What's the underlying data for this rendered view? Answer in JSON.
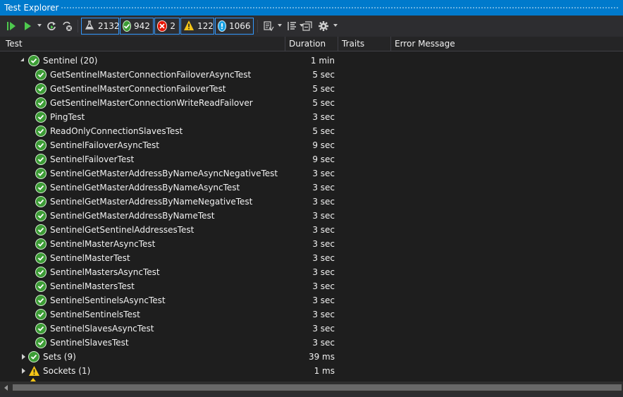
{
  "window": {
    "title": "Test Explorer",
    "accent_color": "#007acc"
  },
  "toolbar": {
    "buttons": [
      {
        "name": "run-all-icon"
      },
      {
        "name": "run-icon"
      },
      {
        "name": "repeat-last-run-icon"
      },
      {
        "name": "cancel-run-icon"
      }
    ],
    "counters": [
      {
        "name": "total-tests-counter",
        "icon": "flask-icon",
        "value": "2132"
      },
      {
        "name": "passed-tests-counter",
        "icon": "passed-icon",
        "value": "942"
      },
      {
        "name": "failed-tests-counter",
        "icon": "failed-icon",
        "value": "2"
      },
      {
        "name": "warning-tests-counter",
        "icon": "warning-icon",
        "value": "122"
      },
      {
        "name": "not-run-tests-counter",
        "icon": "info-icon",
        "value": "1066"
      }
    ],
    "right_buttons": [
      {
        "name": "playlist-icon"
      },
      {
        "name": "group-by-icon"
      },
      {
        "name": "collapse-all-icon"
      },
      {
        "name": "settings-gear-icon"
      }
    ]
  },
  "columns": [
    "Test",
    "Duration",
    "Traits",
    "Error Message"
  ],
  "groups": {
    "sentinel": {
      "label": "Sentinel",
      "count": "(20)",
      "duration": "1 min",
      "status": "passed"
    },
    "sets": {
      "label": "Sets",
      "count": "(9)",
      "duration": "39 ms",
      "status": "passed"
    },
    "sockets": {
      "label": "Sockets",
      "count": "(1)",
      "duration": "1 ms",
      "status": "warning"
    }
  },
  "tests": [
    {
      "name": "GetSentinelMasterConnectionFailoverAsyncTest",
      "duration": "5 sec",
      "status": "passed"
    },
    {
      "name": "GetSentinelMasterConnectionFailoverTest",
      "duration": "5 sec",
      "status": "passed"
    },
    {
      "name": "GetSentinelMasterConnectionWriteReadFailover",
      "duration": "5 sec",
      "status": "passed"
    },
    {
      "name": "PingTest",
      "duration": "3 sec",
      "status": "passed"
    },
    {
      "name": "ReadOnlyConnectionSlavesTest",
      "duration": "5 sec",
      "status": "passed"
    },
    {
      "name": "SentinelFailoverAsyncTest",
      "duration": "9 sec",
      "status": "passed"
    },
    {
      "name": "SentinelFailoverTest",
      "duration": "9 sec",
      "status": "passed"
    },
    {
      "name": "SentinelGetMasterAddressByNameAsyncNegativeTest",
      "duration": "3 sec",
      "status": "passed"
    },
    {
      "name": "SentinelGetMasterAddressByNameAsyncTest",
      "duration": "3 sec",
      "status": "passed"
    },
    {
      "name": "SentinelGetMasterAddressByNameNegativeTest",
      "duration": "3 sec",
      "status": "passed"
    },
    {
      "name": "SentinelGetMasterAddressByNameTest",
      "duration": "3 sec",
      "status": "passed"
    },
    {
      "name": "SentinelGetSentinelAddressesTest",
      "duration": "3 sec",
      "status": "passed"
    },
    {
      "name": "SentinelMasterAsyncTest",
      "duration": "3 sec",
      "status": "passed"
    },
    {
      "name": "SentinelMasterTest",
      "duration": "3 sec",
      "status": "passed"
    },
    {
      "name": "SentinelMastersAsyncTest",
      "duration": "3 sec",
      "status": "passed"
    },
    {
      "name": "SentinelMastersTest",
      "duration": "3 sec",
      "status": "passed"
    },
    {
      "name": "SentinelSentinelsAsyncTest",
      "duration": "3 sec",
      "status": "passed"
    },
    {
      "name": "SentinelSentinelsTest",
      "duration": "3 sec",
      "status": "passed"
    },
    {
      "name": "SentinelSlavesAsyncTest",
      "duration": "3 sec",
      "status": "passed"
    },
    {
      "name": "SentinelSlavesTest",
      "duration": "3 sec",
      "status": "passed"
    }
  ]
}
